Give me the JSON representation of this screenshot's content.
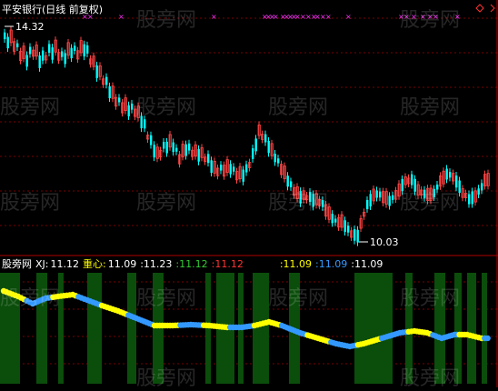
{
  "chart_title": "平安银行(日线 前复权)",
  "price_high_label": "14.32",
  "price_low_label": "10.03",
  "watermark": "股旁网",
  "indicator": {
    "name": "股旁网",
    "xj_label": "XJ:",
    "xj_value": "11.12",
    "center_label": "重心:",
    "center_value": "11.09",
    "values": [
      {
        "text": ":11.23",
        "color": "#ffffff"
      },
      {
        "text": ":11.12",
        "color": "#33cc33"
      },
      {
        "text": ":11.12",
        "color": "#ff3333"
      },
      {
        "text": ":11.09",
        "color": "#ffff00"
      },
      {
        "text": ":11.09",
        "color": "#3399ff"
      },
      {
        "text": ":11.09",
        "color": "#ffffff"
      }
    ]
  },
  "colors": {
    "up": "#ff4444",
    "down": "#00ffff",
    "grid": "#8b0000",
    "signal": "#ff33ff",
    "band": "#0b4d0b",
    "line_yellow": "#ffff00",
    "line_blue": "#3399ff"
  }
}
